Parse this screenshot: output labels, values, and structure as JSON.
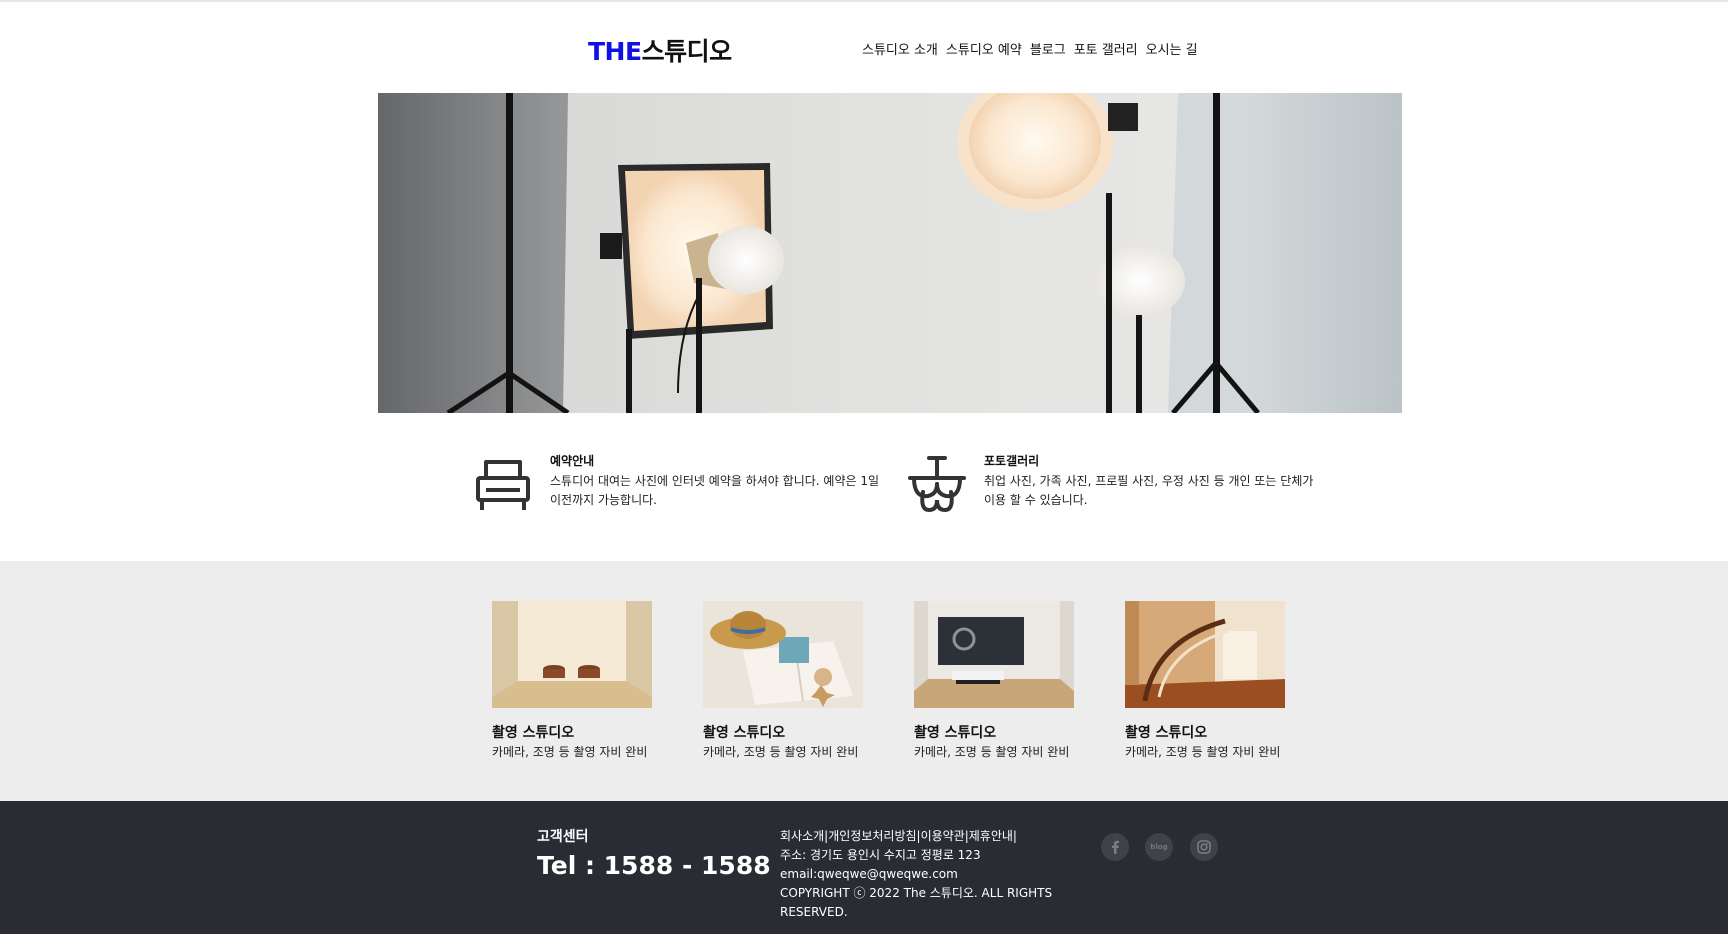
{
  "header": {
    "logo_prefix": "THE",
    "logo_name": "스튜디오",
    "nav": [
      "스튜디오 소개",
      "스튜디오 예약",
      "블로그",
      "포토 갤러리",
      "오시는 길"
    ]
  },
  "info": [
    {
      "icon": "armchair-icon",
      "title": "예약안내",
      "text": "스튜디어 대여는 사진에 인터넷 예약을 하셔야 합니다. 예약은 1일 이전까지 가능합니다."
    },
    {
      "icon": "chandelier-icon",
      "title": "포토갤러리",
      "text": "취업 사진, 가족 사진, 프로필 사진, 우정 사진 등 개인 또는 단체가 이용 할 수 있습니다."
    }
  ],
  "cards": [
    {
      "title": "촬영 스튜디오",
      "desc": "카메라, 조명 등 촬영 자비 완비"
    },
    {
      "title": "촬영 스튜디오",
      "desc": "카메라, 조명 등 촬영 자비 완비"
    },
    {
      "title": "촬영 스튜디오",
      "desc": "카메라, 조명 등 촬영 자비 완비"
    },
    {
      "title": "촬영 스튜디오",
      "desc": "카메라, 조명 등 촬영 자비 완비"
    }
  ],
  "footer": {
    "cs_title": "고객센터",
    "tel": "Tel : 1588 - 1588",
    "links": "회사소개|개인정보처리방침|이용약관|제휴안내|",
    "address": "주소: 경기도 용인시 수지고 정평로 123",
    "email": "email:qweqwe@qweqwe.com",
    "copyright": "COPYRIGHT ⓒ 2022 The 스튜디오. ALL RIGHTS RESERVED.",
    "social": [
      "facebook-icon",
      "blog-icon",
      "instagram-icon"
    ],
    "blog_label": "blog"
  },
  "colors": {
    "logo_accent": "#1111e6",
    "band_bg": "#ededed",
    "footer_bg": "#292c33"
  }
}
